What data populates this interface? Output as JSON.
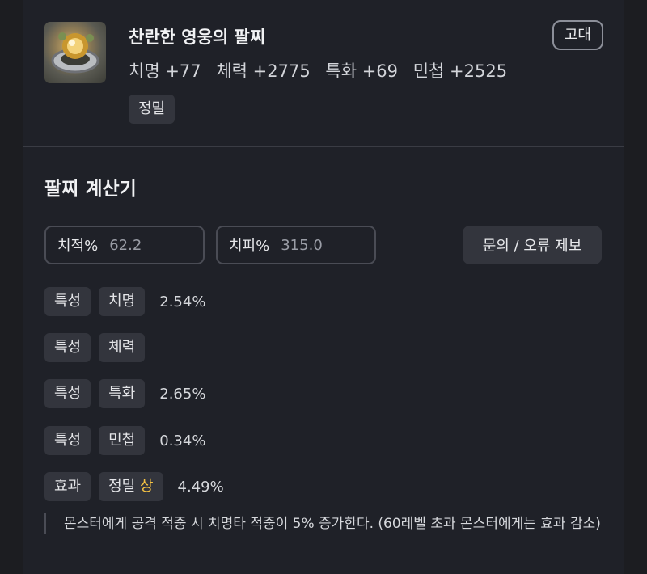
{
  "item": {
    "title": "찬란한 영웅의 팔찌",
    "grade": "고대",
    "icon": "bracelet-icon",
    "stats": [
      "치명 +77",
      "체력 +2775",
      "특화 +69",
      "민첩 +2525"
    ],
    "tag": "정밀"
  },
  "calculator": {
    "title": "팔찌 계산기",
    "crit_rate_label": "치적%",
    "crit_rate_value": "62.2",
    "crit_dmg_label": "치피%",
    "crit_dmg_value": "315.0",
    "report_button": "문의 / 오류 제보",
    "rows": [
      {
        "type": "특성",
        "name": "치명",
        "value": "2.54%"
      },
      {
        "type": "특성",
        "name": "체력",
        "value": ""
      },
      {
        "type": "특성",
        "name": "특화",
        "value": "2.65%"
      },
      {
        "type": "특성",
        "name": "민첩",
        "value": "0.34%"
      }
    ],
    "effect": {
      "type": "효과",
      "name": "정밀",
      "grade": "상",
      "value": "4.49%",
      "description": "몬스터에게 공격 적중 시 치명타 적중이 5% 증가한다. (60레벨 초과 몬스터에게는 효과 감소)"
    }
  }
}
